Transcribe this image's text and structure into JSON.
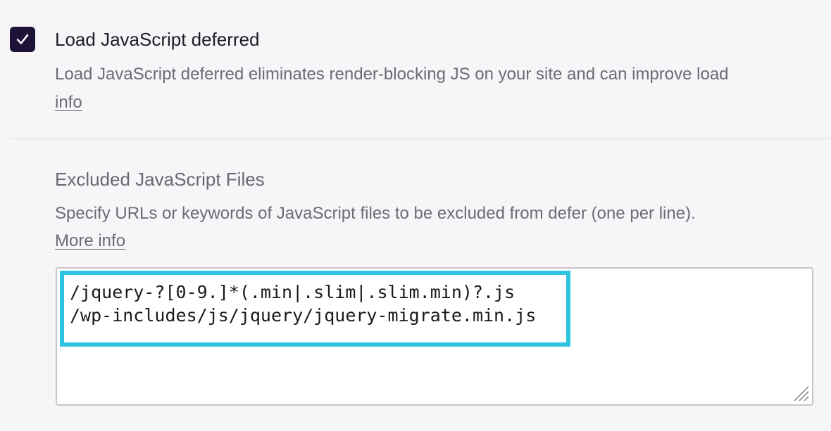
{
  "option": {
    "checked": true,
    "title": "Load JavaScript deferred",
    "description": "Load JavaScript deferred eliminates render-blocking JS on your site and can improve load",
    "info_link": "info"
  },
  "excluded": {
    "title": "Excluded JavaScript Files",
    "description": "Specify URLs or keywords of JavaScript files to be excluded from defer (one per line).",
    "more_info_link": "More info",
    "lines": [
      "/jquery-?[0-9.]*(.min|.slim|.slim.min)?.js",
      "/wp-includes/js/jquery/jquery-migrate.min.js"
    ]
  },
  "colors": {
    "checkbox": "#1f1238",
    "highlight": "#2ec4e0"
  }
}
